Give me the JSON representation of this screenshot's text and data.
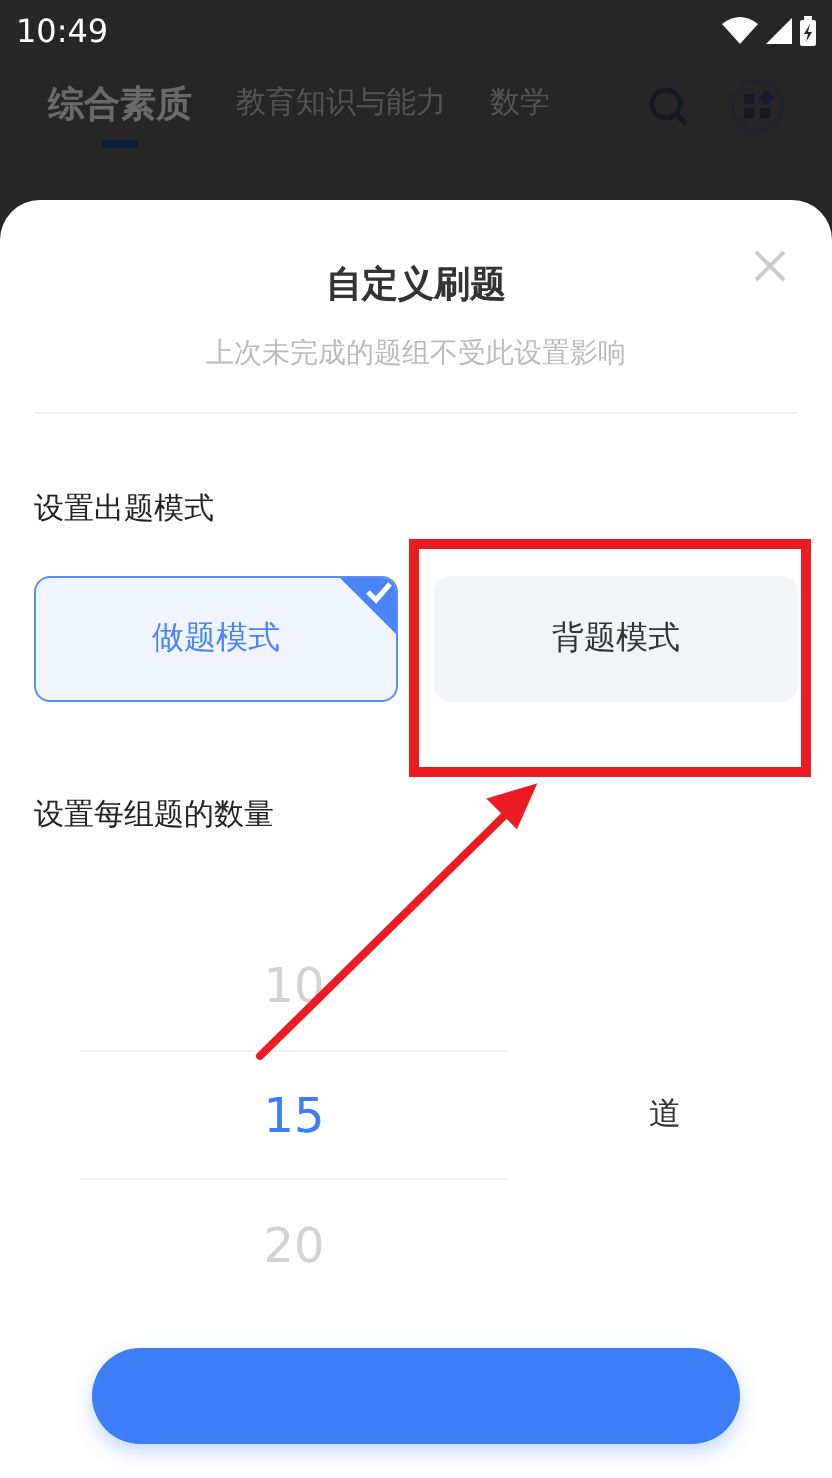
{
  "status_bar": {
    "time": "10:49"
  },
  "tabs": [
    {
      "label": "综合素质",
      "selected": true
    },
    {
      "label": "教育知识与能力",
      "selected": false
    },
    {
      "label": "数学",
      "selected": false
    }
  ],
  "sheet": {
    "title": "自定义刷题",
    "subtitle": "上次未完成的题组不受此设置影响",
    "mode_label": "设置出题模式",
    "modes": [
      {
        "label": "做题模式",
        "selected": true
      },
      {
        "label": "背题模式",
        "selected": false
      }
    ],
    "count_label": "设置每组题的数量",
    "picker": {
      "options": [
        {
          "label": "10",
          "selected": false
        },
        {
          "label": "15",
          "selected": true
        },
        {
          "label": "20",
          "selected": false
        }
      ],
      "unit": "道"
    }
  }
}
